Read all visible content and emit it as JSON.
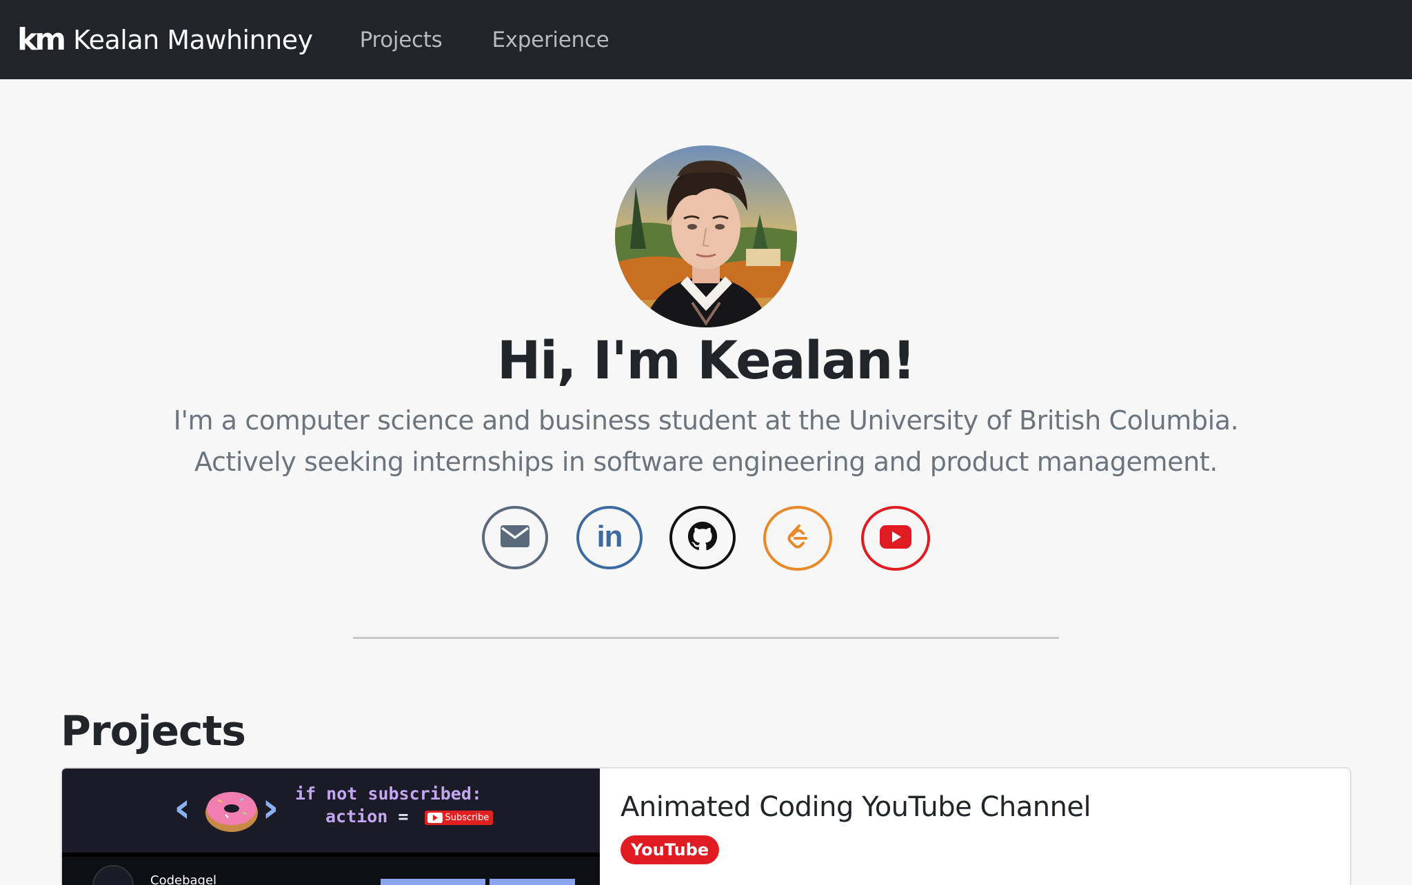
{
  "navbar": {
    "logo": "km",
    "brand_name": "Kealan Mawhinney",
    "links": [
      "Projects",
      "Experience"
    ]
  },
  "hero": {
    "title": "Hi, I'm Kealan!",
    "line1": "I'm a computer science and business student at the University of British Columbia.",
    "line2": "Actively seeking internships in software engineering and product management."
  },
  "socials": [
    {
      "name": "email",
      "icon": "envelope-icon",
      "color": "#5a6a7c"
    },
    {
      "name": "linkedin",
      "icon": "linkedin-icon",
      "color": "#3d6aa0",
      "glyph": "in"
    },
    {
      "name": "github",
      "icon": "github-icon",
      "color": "#111111"
    },
    {
      "name": "leetcode",
      "icon": "leetcode-icon",
      "color": "#e8892a"
    },
    {
      "name": "youtube",
      "icon": "youtube-icon",
      "color": "#e01b22"
    }
  ],
  "projects": {
    "heading": "Projects",
    "items": [
      {
        "title": "Animated Coding YouTube Channel",
        "badge": "YouTube",
        "thumbnail": {
          "code_line1_kw1": "if",
          "code_line1_kw2": "not",
          "code_line1_kw3": "subscribed:",
          "code_line2_a": "action",
          "code_line2_b": "=",
          "subscribe_label": "Subscribe",
          "channel_name": "Codebagel"
        }
      }
    ]
  }
}
